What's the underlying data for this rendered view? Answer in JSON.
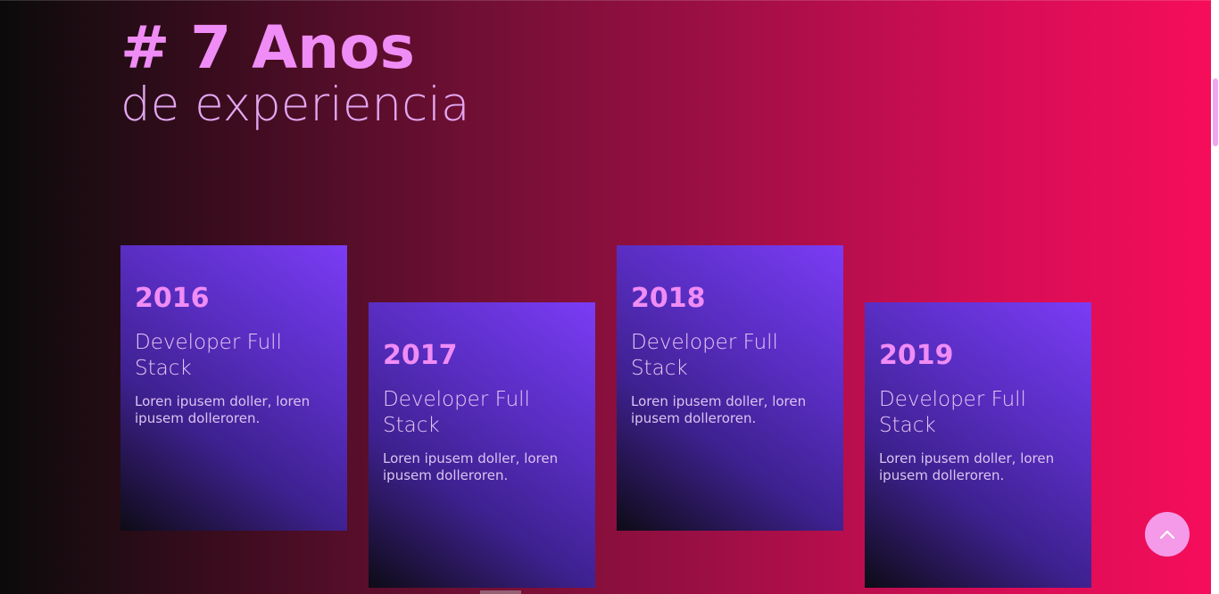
{
  "hero": {
    "title": "# 7 Anos",
    "subtitle": "de experiencia"
  },
  "timeline": [
    {
      "year": "2016",
      "role": "Developer Full Stack",
      "description": "Loren ipusem doller, loren ipusem dolleroren."
    },
    {
      "year": "2017",
      "role": "Developer Full Stack",
      "description": "Loren ipusem doller, loren ipusem dolleroren."
    },
    {
      "year": "2018",
      "role": "Developer Full Stack",
      "description": "Loren ipusem doller, loren ipusem dolleroren."
    },
    {
      "year": "2019",
      "role": "Developer Full Stack",
      "description": "Loren ipusem doller, loren ipusem dolleroren."
    }
  ],
  "scroll_top_button": {
    "icon": "chevron-up-icon"
  },
  "colors": {
    "accent": "#f08cf5",
    "card_top": "#7b3cf5",
    "background_right": "#f70d5a",
    "background_left": "#0b0b0b"
  }
}
